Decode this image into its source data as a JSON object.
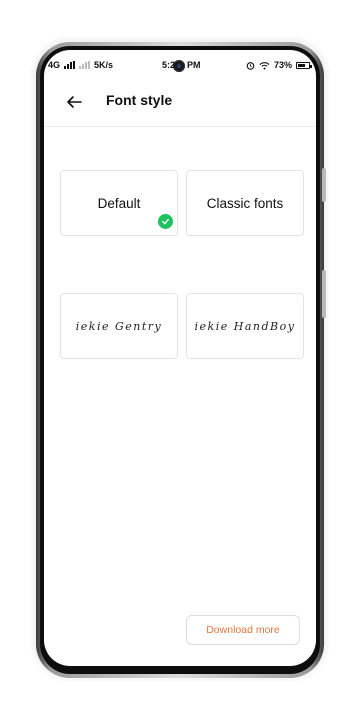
{
  "status_bar": {
    "network": "4G",
    "speed": "5K/s",
    "time": "5:2",
    "time_suffix": "PM",
    "battery": "73%",
    "battery_level": 0.73,
    "icons": [
      "signal-icon",
      "alarm-icon",
      "wifi-icon",
      "battery-icon"
    ]
  },
  "header": {
    "title": "Font style",
    "back_icon": "back-arrow-icon"
  },
  "fonts": [
    {
      "label": "Default",
      "selected": true
    },
    {
      "label": "Classic fonts",
      "selected": false
    },
    {
      "label": "iekie Gentry",
      "selected": false
    },
    {
      "label": "iekie HandBoy",
      "selected": false
    }
  ],
  "download_label": "Download more",
  "colors": {
    "accent": "#e2763e",
    "selected_check": "#1fc160"
  }
}
